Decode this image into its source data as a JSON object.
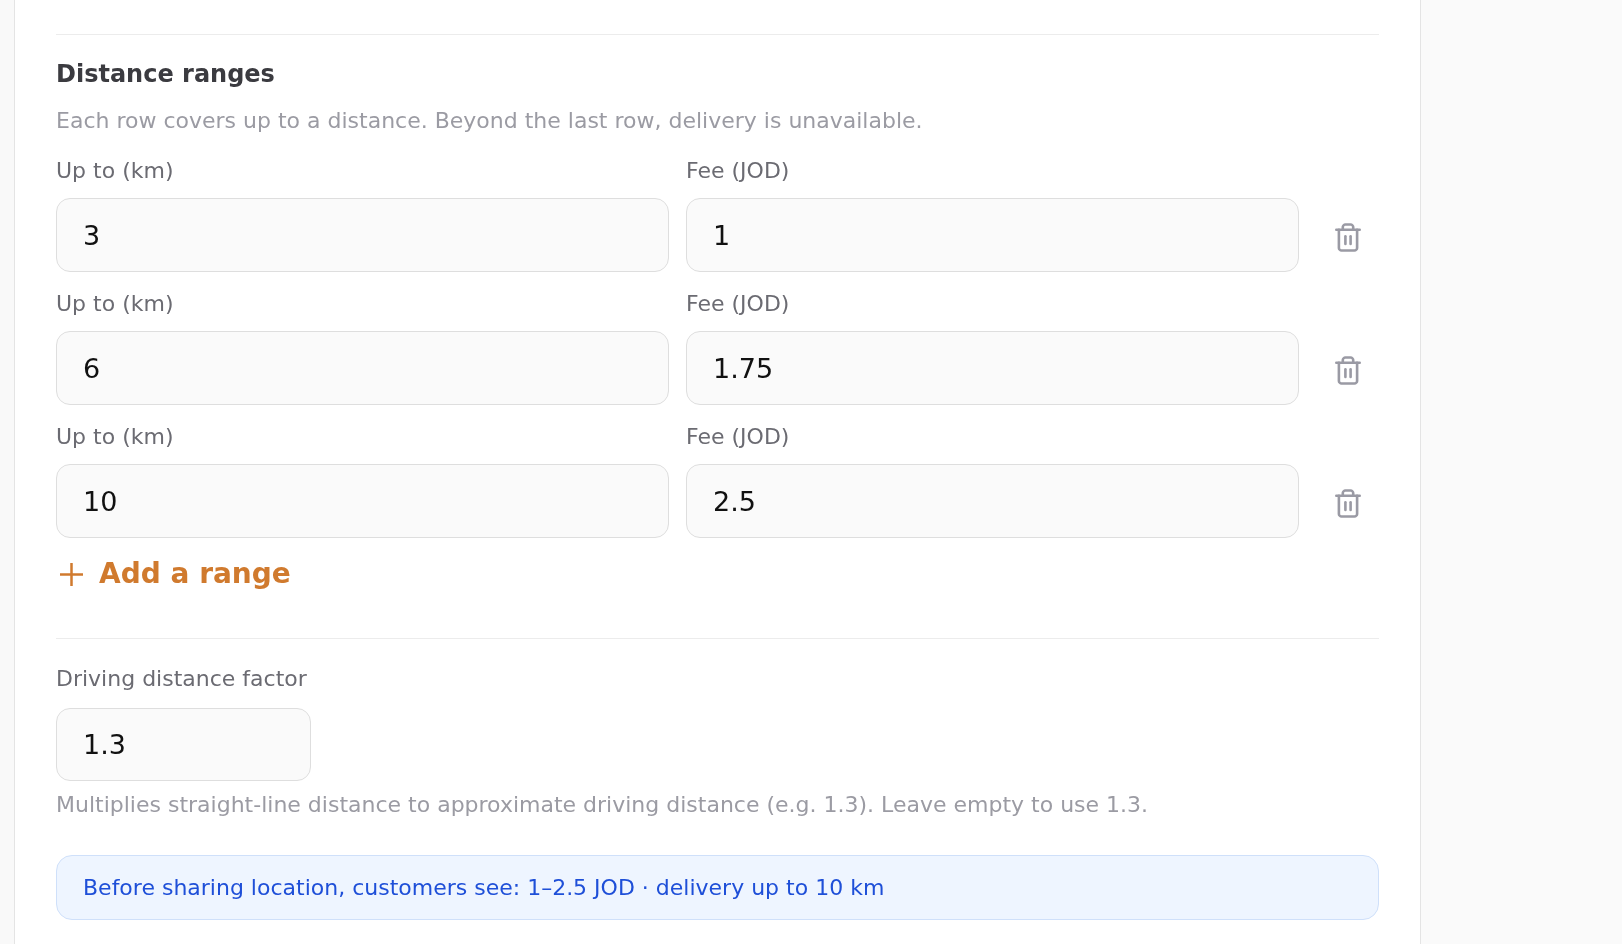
{
  "section": {
    "title": "Distance ranges",
    "description": "Each row covers up to a distance. Beyond the last row, delivery is unavailable."
  },
  "ranges": [
    {
      "distance_label": "Up to (km)",
      "distance": "3",
      "fee_label": "Fee (JOD)",
      "fee": "1"
    },
    {
      "distance_label": "Up to (km)",
      "distance": "6",
      "fee_label": "Fee (JOD)",
      "fee": "1.75"
    },
    {
      "distance_label": "Up to (km)",
      "distance": "10",
      "fee_label": "Fee (JOD)",
      "fee": "2.5"
    }
  ],
  "add_button": {
    "label": "Add a range"
  },
  "factor": {
    "label": "Driving distance factor",
    "value": "1.3",
    "help": "Multiplies straight-line distance to approximate driving distance (e.g. 1.3). Leave empty to use 1.3."
  },
  "info_banner": {
    "text": "Before sharing location, customers see: 1–2.5 JOD · delivery up to 10 km"
  }
}
